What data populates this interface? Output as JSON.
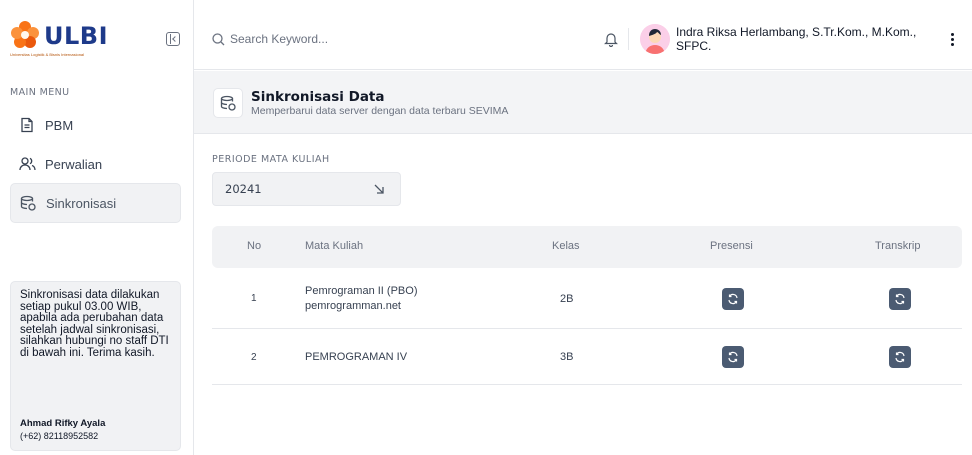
{
  "brand": {
    "logo_text": "ULBI",
    "logo_sub": "Universitas Logistik & Bisnis Internasional"
  },
  "sidebar": {
    "menu_title": "MAIN MENU",
    "items": [
      {
        "label": "PBM",
        "icon": "document-icon"
      },
      {
        "label": "Perwalian",
        "icon": "users-icon"
      },
      {
        "label": "Sinkronisasi",
        "icon": "database-sync-icon"
      }
    ],
    "info": {
      "text": "Sinkronisasi data dilakukan setiap pukul 03.00 WIB, apabila ada perubahan data setelah jadwal sinkronisasi, silahkan hubungi no staff DTI di bawah ini. Terima kasih.",
      "contact_name": "Ahmad Rifky Ayala",
      "contact_phone": "(+62) 82118952582"
    }
  },
  "header": {
    "search_placeholder": "Search Keyword...",
    "user_name": "Indra Riksa Herlambang, S.Tr.Kom., M.Kom., SFPC."
  },
  "page": {
    "title": "Sinkronisasi Data",
    "subtitle": "Memperbarui data server dengan data terbaru SEVIMA"
  },
  "filter": {
    "label": "PERIODE MATA KULIAH",
    "value": "20241"
  },
  "table": {
    "columns": [
      "No",
      "Mata Kuliah",
      "Kelas",
      "Presensi",
      "Transkrip"
    ],
    "rows": [
      {
        "no": "1",
        "course": "Pemrograman II (PBO)",
        "course_sub": "pemrogramman.net",
        "kelas": "2B"
      },
      {
        "no": "2",
        "course": "PEMROGRAMAN IV",
        "course_sub": "",
        "kelas": "3B"
      }
    ]
  },
  "colors": {
    "brand_blue": "#1e3a8a",
    "brand_orange": "#f97316",
    "sync_button": "#4b5b72"
  }
}
